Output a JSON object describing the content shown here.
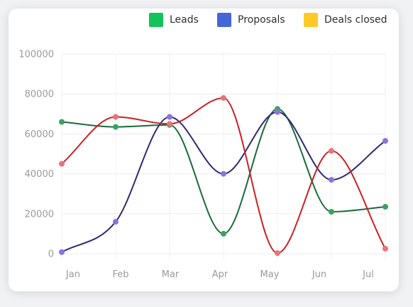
{
  "chart_data": {
    "type": "line",
    "categories": [
      "Jan",
      "Feb",
      "Mar",
      "Apr",
      "May",
      "Jun",
      "Jul"
    ],
    "ylim": [
      0,
      100000
    ],
    "yticks": [
      0,
      20000,
      40000,
      60000,
      80000,
      100000
    ],
    "grid": true,
    "legend_position": "top-right",
    "series": [
      {
        "name": "Leads",
        "color": "#1a6b3a",
        "legend_color": "#13c35a",
        "marker_color": "#3aa361",
        "values": [
          66000,
          63500,
          64500,
          10000,
          72500,
          21000,
          23500
        ]
      },
      {
        "name": "Proposals",
        "color": "#2e2a73",
        "legend_color": "#4466d8",
        "marker_color": "#8f71e0",
        "values": [
          800,
          16000,
          68500,
          40000,
          71000,
          37000,
          56500
        ]
      },
      {
        "name": "Deals closed",
        "color": "#cc1f24",
        "legend_color": "#ffca28",
        "marker_color": "#e8737a",
        "values": [
          45000,
          68500,
          65000,
          78000,
          300,
          51500,
          2500
        ]
      }
    ]
  }
}
